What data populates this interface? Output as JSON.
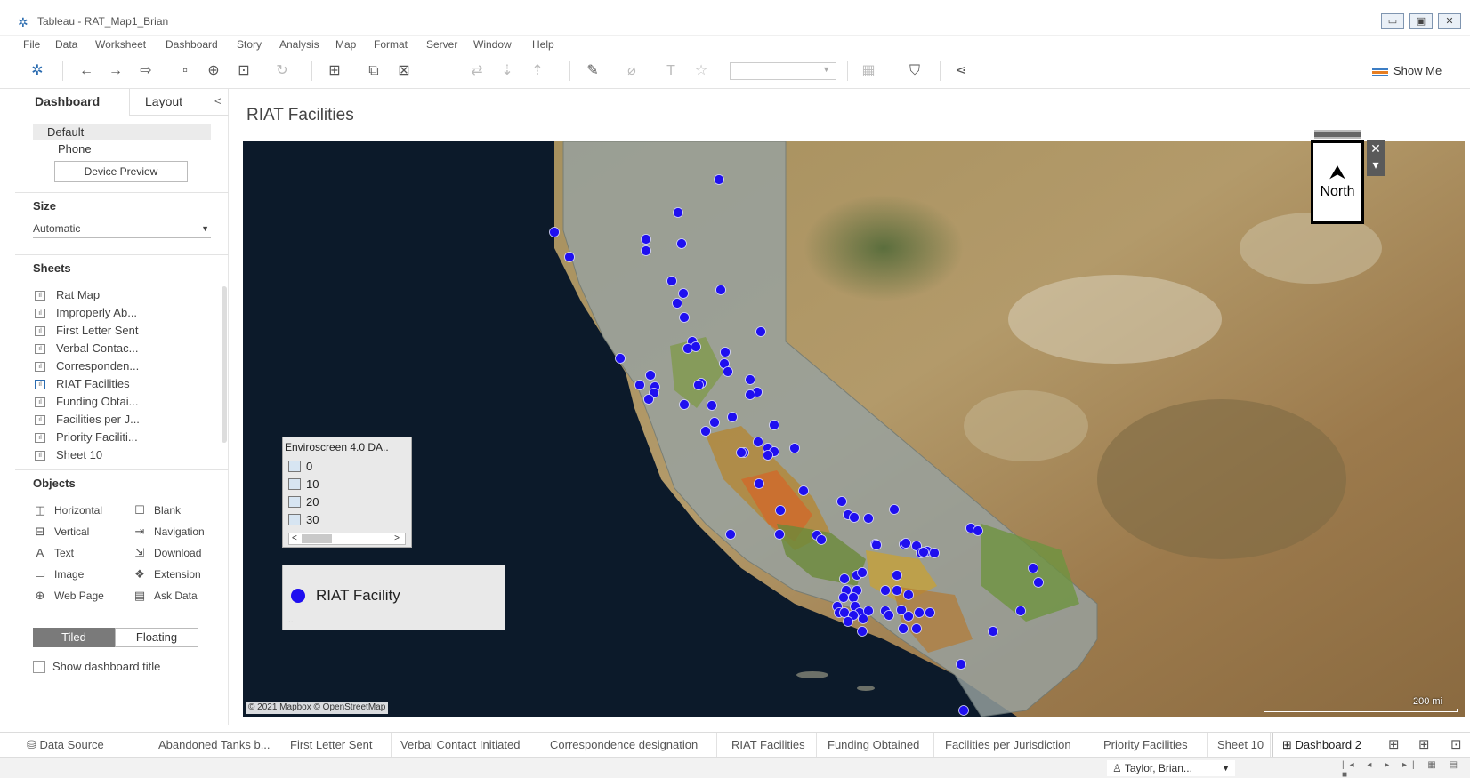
{
  "window": {
    "title": "Tableau - RAT_Map1_Brian",
    "controls": {
      "minimize": "▭",
      "maximize": "▣",
      "close": "✕"
    }
  },
  "menu": [
    "File",
    "Data",
    "Worksheet",
    "Dashboard",
    "Story",
    "Analysis",
    "Map",
    "Format",
    "Server",
    "Window",
    "Help"
  ],
  "toolbar": {
    "show_me": "Show Me"
  },
  "left_pane": {
    "tabs": {
      "dashboard": "Dashboard",
      "layout": "Layout",
      "collapse": "<"
    },
    "device": {
      "default": "Default",
      "phone": "Phone",
      "preview_button": "Device Preview"
    },
    "size": {
      "heading": "Size",
      "value": "Automatic"
    },
    "sheets": {
      "heading": "Sheets",
      "items": [
        "Rat Map",
        "Improperly Ab...",
        "First Letter Sent",
        "Verbal Contac...",
        "Corresponden...",
        "RIAT Facilities",
        "Funding Obtai...",
        "Facilities per J...",
        "Priority Faciliti...",
        "Sheet 10"
      ]
    },
    "objects": {
      "heading": "Objects",
      "items": [
        "Horizontal",
        "Blank",
        "Vertical",
        "Navigation",
        "Text",
        "Download",
        "Image",
        "Extension",
        "Web Page",
        "Ask Data"
      ]
    },
    "mode": {
      "tiled": "Tiled",
      "floating": "Floating"
    },
    "show_title": "Show dashboard title"
  },
  "dashboard": {
    "title": "RIAT Facilities",
    "attribution": "© 2021 Mapbox © OpenStreetMap",
    "scale": "200 mi",
    "north": "North",
    "north_arrow": "⮝",
    "enviro_legend": {
      "title": "Enviroscreen 4.0 DA..",
      "items": [
        "0",
        "10",
        "20",
        "30"
      ],
      "scroll_left": "<",
      "scroll_right": ">"
    },
    "riat_legend": {
      "label": "RIAT Facility",
      "more": ".."
    },
    "colors": {
      "facility": "#1f0ff0",
      "water": "#0c1a2a"
    }
  },
  "sheet_tabs": {
    "data_source": "Data Source",
    "tabs": [
      "Abandoned Tanks b...",
      "First Letter Sent",
      "Verbal Contact Initiated",
      "Correspondence designation",
      "RIAT Facilities",
      "Funding Obtained",
      "Facilities per Jurisdiction",
      "Priority Facilities",
      "Sheet 10"
    ],
    "active": "Dashboard 2"
  },
  "status": {
    "user": "Taylor, Brian..."
  }
}
